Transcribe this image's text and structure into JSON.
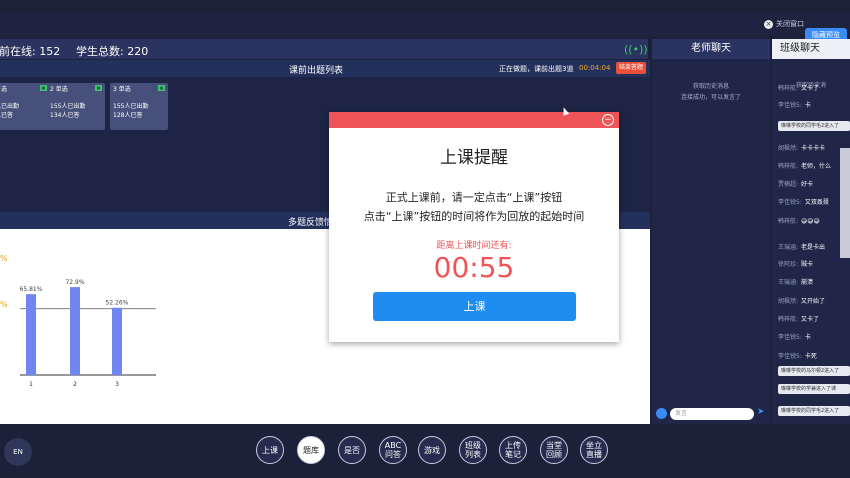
{
  "subbar": {
    "close_window": "关闭窗口",
    "reserve": "隐藏预览"
  },
  "stats": {
    "online": "前在线: 152",
    "total": "学生总数: 220"
  },
  "question_list": {
    "title": "课前出题列表",
    "status": "正在做题，课前出题3道",
    "timer": "00:04:04",
    "end_label": "结束答题",
    "cards": [
      {
        "type": "选",
        "line1": "入已出勤",
        "line2": "入已答"
      },
      {
        "type": "2 单选",
        "line1": "155人已出勤",
        "line2": "134人已答"
      },
      {
        "type": "3 单选",
        "line1": "155人已出勤",
        "line2": "128人已答"
      }
    ]
  },
  "feedback": {
    "title": "多题反馈情"
  },
  "chart_data": {
    "type": "bar",
    "categories": [
      "1",
      "2",
      "3"
    ],
    "values": [
      65.81,
      72.9,
      52.26
    ],
    "labels": [
      "65.81%",
      "72.9%",
      "52.26%"
    ],
    "color": "#6f86f0",
    "side_labels": [
      "%",
      "%"
    ]
  },
  "teacher_chat": {
    "title": "老师聊天",
    "history": "获取历史消息",
    "connected": "连接成功，可以发言了",
    "input_placeholder": "发言"
  },
  "class_chat": {
    "title": "班级聊天",
    "history": "获取历史消",
    "messages": [
      {
        "name": "韩梓航:",
        "text": "又卡了"
      },
      {
        "name": "李佳锐5:",
        "text": "卡"
      },
      {
        "name": "胡枫然:",
        "text": "卡卡卡卡"
      },
      {
        "name": "韩梓航:",
        "text": "老师，什么"
      },
      {
        "name": "贾楠超:",
        "text": "好卡"
      },
      {
        "name": "李佳锐5:",
        "text": "又双叒叕"
      },
      {
        "name": "韩梓航:",
        "text": "😅😅😅"
      },
      {
        "name": "王瑞涵:",
        "text": "老是卡出"
      },
      {
        "name": "徐阿珍:",
        "text": "贼卡"
      },
      {
        "name": "王瑞涵:",
        "text": "崩溃"
      },
      {
        "name": "胡枫然:",
        "text": "又开始了"
      },
      {
        "name": "韩梓航:",
        "text": "又卡了"
      },
      {
        "name": "李佳锐5:",
        "text": "卡"
      },
      {
        "name": "李佳锐5:",
        "text": "卡死"
      }
    ],
    "notes": [
      "琳琳学校的同学毛2进入了",
      "琳琳学校的马尔顿2进入了",
      "琳琳学校的学兼进入了课",
      "琳琳学校的同学毛2进入了"
    ]
  },
  "toolbar": {
    "logo": "EN",
    "items": [
      "上课",
      "题库",
      "是否",
      "ABC 问答",
      "游戏",
      "班级 列表",
      "上传 笔记",
      "当堂 回顾",
      "坐立 直播"
    ]
  },
  "modal": {
    "title": "上课提醒",
    "line1": "正式上课前，请一定点击“上课”按钮",
    "line2": "点击“上课”按钮的时间将作为回放的起始时间",
    "count_label": "距离上课时间还有:",
    "count": "00:55",
    "button": "上课"
  }
}
